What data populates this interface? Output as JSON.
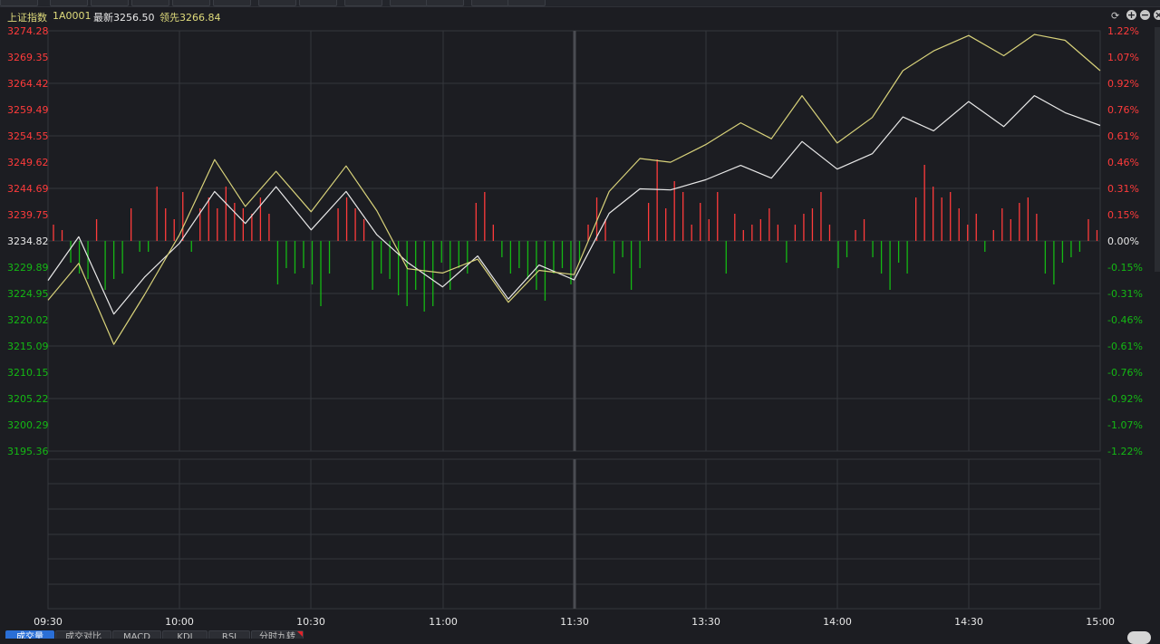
{
  "header": {
    "index_name": "上证指数",
    "code": "1A0001",
    "latest_label": "最新3256.50",
    "leading_label": "领先3266.84"
  },
  "colors": {
    "up": "#ff3b3b",
    "down": "#14b814",
    "neutral": "#e8e8e8",
    "leading_line": "#d8d27a",
    "price_line": "#e9e9e9",
    "grid": "#34363c",
    "background": "#1c1d22"
  },
  "icons": [
    "refresh-icon",
    "zoom-in-icon",
    "zoom-out-icon",
    "close-icon"
  ],
  "axes": {
    "left": [
      "3274.28",
      "3269.35",
      "3264.42",
      "3259.49",
      "3254.55",
      "3249.62",
      "3244.69",
      "3239.75",
      "3234.82",
      "3229.89",
      "3224.95",
      "3220.02",
      "3215.09",
      "3210.15",
      "3205.22",
      "3200.29",
      "3195.36"
    ],
    "right": [
      "1.22%",
      "1.07%",
      "0.92%",
      "0.76%",
      "0.61%",
      "0.46%",
      "0.31%",
      "0.15%",
      "0.00%",
      "-0.15%",
      "-0.31%",
      "-0.46%",
      "-0.61%",
      "-0.76%",
      "-0.92%",
      "-1.07%",
      "-1.22%"
    ],
    "time": [
      "09:30",
      "10:00",
      "10:30",
      "11:00",
      "11:30",
      "13:30",
      "14:00",
      "14:30",
      "15:00"
    ]
  },
  "tabs": [
    {
      "label": "成交量",
      "active": true
    },
    {
      "label": "成交对比",
      "active": false
    },
    {
      "label": "MACD",
      "active": false
    },
    {
      "label": "KDJ",
      "active": false
    },
    {
      "label": "RSI",
      "active": false
    },
    {
      "label": "分时九转",
      "active": false,
      "flag": true
    }
  ],
  "chart_data": {
    "type": "line",
    "title": "上证指数 1A0001",
    "x_range": [
      "09:30",
      "15:00"
    ],
    "y_range": [
      3195.36,
      3274.28
    ],
    "base_value": 3234.82,
    "pct_range": [
      "-1.22%",
      "1.22%"
    ],
    "series": [
      {
        "name": "最新",
        "x": [
          "09:30",
          "09:37",
          "09:45",
          "09:52",
          "10:00",
          "10:08",
          "10:15",
          "10:22",
          "10:30",
          "10:38",
          "10:45",
          "10:52",
          "11:00",
          "11:08",
          "11:15",
          "11:22",
          "11:30",
          "13:08",
          "13:15",
          "13:22",
          "13:30",
          "13:38",
          "13:45",
          "13:52",
          "14:00",
          "14:08",
          "14:15",
          "14:22",
          "14:30",
          "14:38",
          "14:45",
          "14:52",
          "15:00"
        ],
        "values": [
          3227.4,
          3235.6,
          3221.1,
          3228.0,
          3234.4,
          3244.1,
          3238.1,
          3245.0,
          3236.9,
          3244.1,
          3236.0,
          3230.8,
          3226.2,
          3232.0,
          3223.9,
          3230.3,
          3227.5,
          3240.0,
          3244.6,
          3244.4,
          3246.3,
          3249.0,
          3246.6,
          3253.5,
          3248.3,
          3251.2,
          3258.1,
          3255.5,
          3261.0,
          3256.3,
          3262.1,
          3258.9,
          3256.5
        ]
      },
      {
        "name": "领先",
        "x": [
          "09:30",
          "09:37",
          "09:45",
          "09:52",
          "10:00",
          "10:08",
          "10:15",
          "10:22",
          "10:30",
          "10:38",
          "10:45",
          "10:52",
          "11:00",
          "11:08",
          "11:15",
          "11:22",
          "11:30",
          "13:08",
          "13:15",
          "13:22",
          "13:30",
          "13:38",
          "13:45",
          "13:52",
          "14:00",
          "14:08",
          "14:15",
          "14:22",
          "14:30",
          "14:38",
          "14:45",
          "14:52",
          "15:00"
        ],
        "values": [
          3223.7,
          3230.6,
          3215.4,
          3224.7,
          3236.0,
          3250.1,
          3241.3,
          3247.9,
          3240.3,
          3248.9,
          3240.5,
          3229.6,
          3228.8,
          3231.4,
          3223.3,
          3229.3,
          3228.5,
          3244.1,
          3250.3,
          3249.6,
          3252.9,
          3257.0,
          3254.0,
          3262.1,
          3253.2,
          3258.0,
          3266.8,
          3270.5,
          3273.4,
          3269.6,
          3273.6,
          3272.5,
          3266.8
        ]
      }
    ],
    "volume_bars": [
      0.3,
      0.2,
      -0.4,
      -0.6,
      -0.7,
      0.4,
      -0.9,
      -0.7,
      -0.6,
      0.6,
      -0.2,
      -0.2,
      1.0,
      0.6,
      0.4,
      0.9,
      -0.2,
      0.6,
      0.8,
      0.6,
      1.0,
      0.7,
      0.6,
      0.5,
      0.8,
      0.5,
      -0.8,
      -0.5,
      -0.6,
      -0.5,
      -0.8,
      -1.2,
      -0.6,
      0.6,
      0.8,
      0.6,
      0.4,
      -0.9,
      -0.6,
      -0.7,
      -1.0,
      -1.2,
      -0.9,
      -1.3,
      -1.2,
      -0.4,
      -0.9,
      -0.5,
      -0.6,
      0.7,
      0.9,
      0.3,
      -0.3,
      -0.6,
      -0.5,
      -0.7,
      -0.9,
      -1.1,
      -0.6,
      -0.5,
      -0.8,
      -0.4,
      0.3,
      0.8,
      0.4,
      -0.6,
      -0.3,
      -0.9,
      -0.5,
      0.7,
      1.5,
      0.6,
      1.1,
      0.9,
      0.3,
      0.7,
      0.4,
      0.9,
      -0.6,
      0.5,
      0.2,
      0.3,
      0.4,
      0.6,
      0.3,
      -0.4,
      0.3,
      0.5,
      0.6,
      0.9,
      0.3,
      -0.5,
      -0.3,
      0.2,
      0.4,
      -0.3,
      -0.6,
      -0.9,
      -0.4,
      -0.6,
      0.8,
      1.4,
      1.0,
      0.8,
      0.9,
      0.6,
      0.3,
      0.5,
      -0.2,
      0.2,
      0.6,
      0.4,
      0.7,
      0.8,
      0.5,
      -0.6,
      -0.8,
      -0.4,
      -0.3,
      -0.2,
      0.4,
      0.2
    ]
  }
}
